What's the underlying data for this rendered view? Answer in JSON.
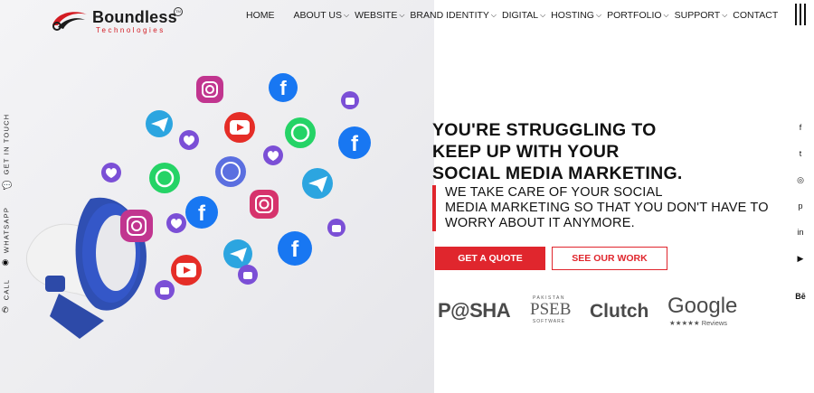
{
  "brand": {
    "name": "Boundless",
    "tagline": "Technologies",
    "tm": "TM"
  },
  "nav": {
    "items": [
      {
        "label": "HOME",
        "dropdown": false
      },
      {
        "label": "ABOUT US",
        "dropdown": true
      },
      {
        "label": "WEBSITE",
        "dropdown": true
      },
      {
        "label": "BRAND IDENTITY",
        "dropdown": true
      },
      {
        "label": "DIGITAL",
        "dropdown": true
      },
      {
        "label": "HOSTING",
        "dropdown": true
      },
      {
        "label": "PORTFOLIO",
        "dropdown": true
      },
      {
        "label": "SUPPORT",
        "dropdown": true
      },
      {
        "label": "CONTACT",
        "dropdown": false
      }
    ]
  },
  "side_contact": {
    "call": "CALL",
    "whatsapp": "WHATSAPP",
    "get_in_touch": "GET IN TOUCH"
  },
  "social": {
    "facebook": "f",
    "twitter": "t",
    "instagram": "◎",
    "pinterest": "p",
    "linkedin": "in",
    "youtube": "▶",
    "behance": "Bē"
  },
  "hero": {
    "headline_lines": [
      "YOU'RE STRUGGLING TO",
      "KEEP UP WITH YOUR",
      "SOCIAL MEDIA MARKETING."
    ],
    "sub_lines": [
      "WE TAKE CARE OF YOUR SOCIAL",
      "MEDIA MARKETING SO THAT YOU DON'T HAVE TO",
      "WORRY ABOUT IT ANYMORE."
    ],
    "primary_cta": "GET A QUOTE",
    "secondary_cta": "SEE OUR WORK"
  },
  "partners": {
    "pasha": "P@SHA",
    "pseb_top": "PAKISTAN",
    "pseb_mid": "PSEB",
    "pseb_bot": "SOFTWARE",
    "clutch": "Clutch",
    "google": "Google",
    "google_sub": "★★★★★ Reviews"
  },
  "colors": {
    "accent": "#e0262d",
    "text": "#111111",
    "facebook": "#1877f2",
    "instagram": "#c1358f",
    "youtube": "#e52d27",
    "whatsapp": "#25d366",
    "telegram": "#2ca5e0",
    "like": "#7b4fd6"
  }
}
